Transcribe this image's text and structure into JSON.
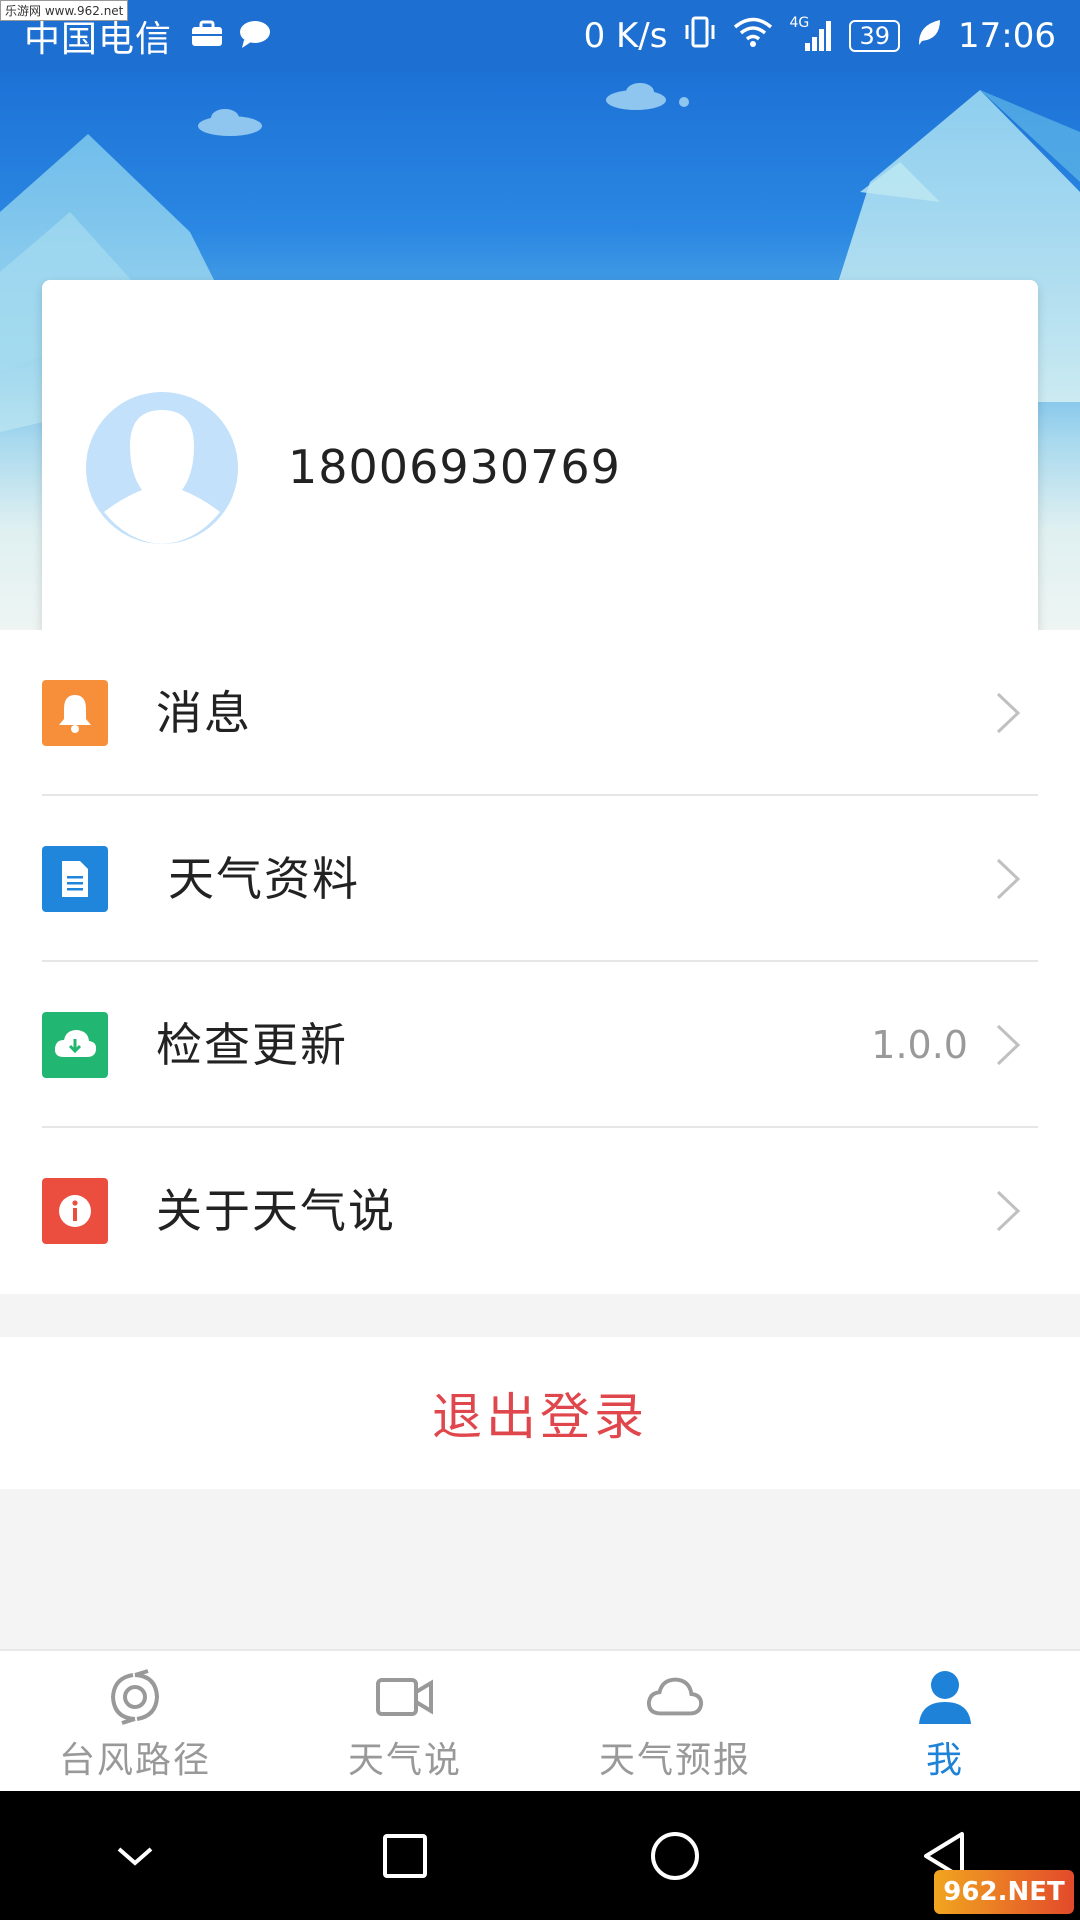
{
  "status_bar": {
    "carrier": "中国电信",
    "net_speed": "0 K/s",
    "network": "4G",
    "battery": "39",
    "time": "17:06",
    "watermark": "乐游网 www.962.net"
  },
  "profile": {
    "phone": "18006930769"
  },
  "menu": {
    "items": [
      {
        "label": "消息",
        "icon": "bell-icon",
        "color": "#f78e3a",
        "value": ""
      },
      {
        "label": "天气资料",
        "icon": "document-icon",
        "color": "#1f86dc",
        "value": ""
      },
      {
        "label": "检查更新",
        "icon": "cloud-download-icon",
        "color": "#21b672",
        "value": "1.0.0"
      },
      {
        "label": "关于天气说",
        "icon": "info-icon",
        "color": "#eb4d3f",
        "value": ""
      }
    ]
  },
  "logout": {
    "label": "退出登录",
    "color": "#e0474c"
  },
  "tabbar": {
    "tabs": [
      {
        "label": "台风路径",
        "icon": "typhoon-icon",
        "active": false
      },
      {
        "label": "天气说",
        "icon": "video-camera-icon",
        "active": false
      },
      {
        "label": "天气预报",
        "icon": "cloud-icon",
        "active": false
      },
      {
        "label": "我",
        "icon": "user-icon",
        "active": true
      }
    ],
    "active_color": "#1e83d8"
  },
  "watermark_bottom": "962.NET"
}
